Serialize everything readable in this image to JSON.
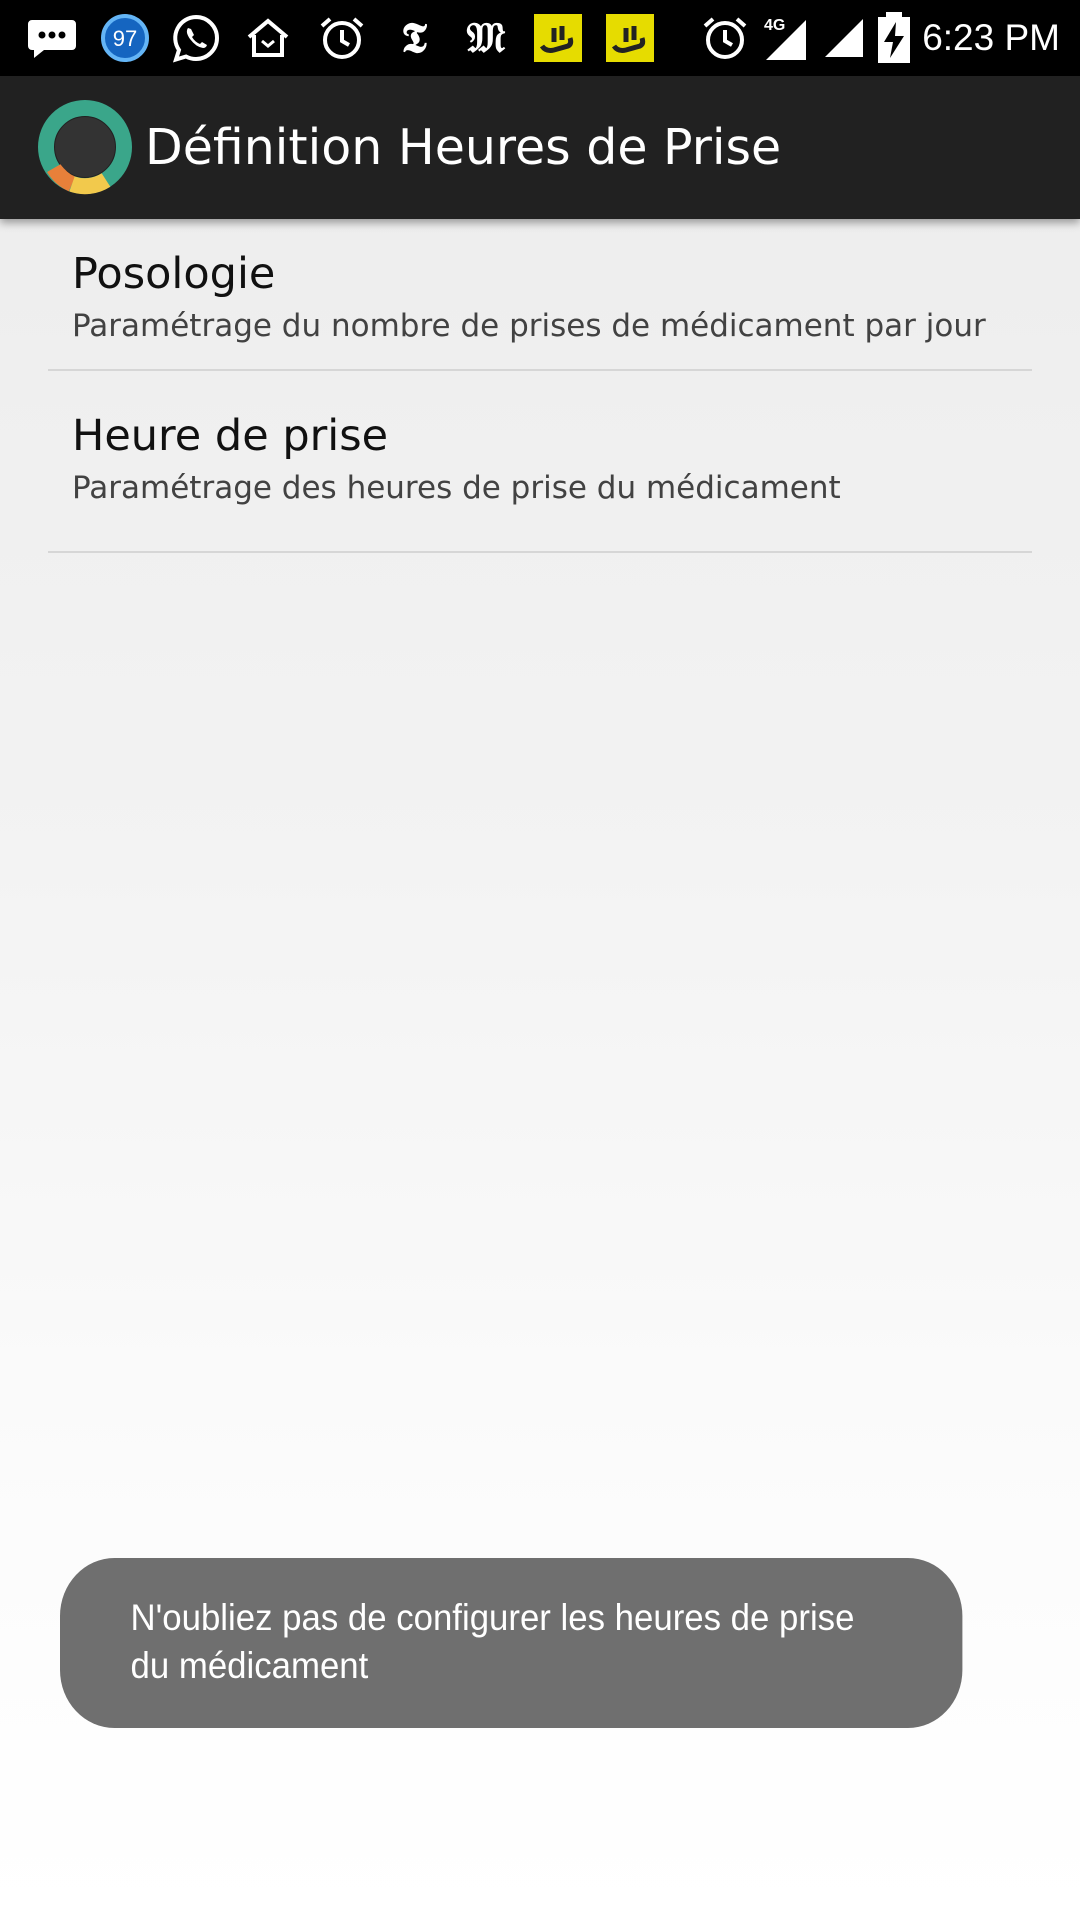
{
  "status_bar": {
    "time": "6:23 PM",
    "badge_count": "97",
    "network_type": "4G",
    "icons": [
      "message-icon",
      "badge-97-icon",
      "whatsapp-icon",
      "home-icon",
      "alarm-icon",
      "nyt-icon",
      "le-monde-icon",
      "yellow-app-icon",
      "yellow-app-icon",
      "alarm-icon",
      "signal-4g-icon",
      "signal-icon",
      "battery-charging-icon"
    ]
  },
  "action_bar": {
    "title": "Définition Heures de Prise"
  },
  "preferences": [
    {
      "title": "Posologie",
      "summary": "Paramétrage du nombre de prises de médicament par jour"
    },
    {
      "title": "Heure de prise",
      "summary": "Paramétrage des heures de prise du médicament"
    }
  ],
  "toast": {
    "message": "N'oubliez pas de configurer les heures de prise du médicament"
  },
  "colors": {
    "status_bar": "#000000",
    "action_bar": "#212121",
    "toast_bg": "#6f6f6f",
    "logo_teal": "#3aa68a",
    "logo_yellow": "#f2c94c",
    "logo_orange": "#e8803a",
    "notification_yellow": "#e6dc00"
  }
}
